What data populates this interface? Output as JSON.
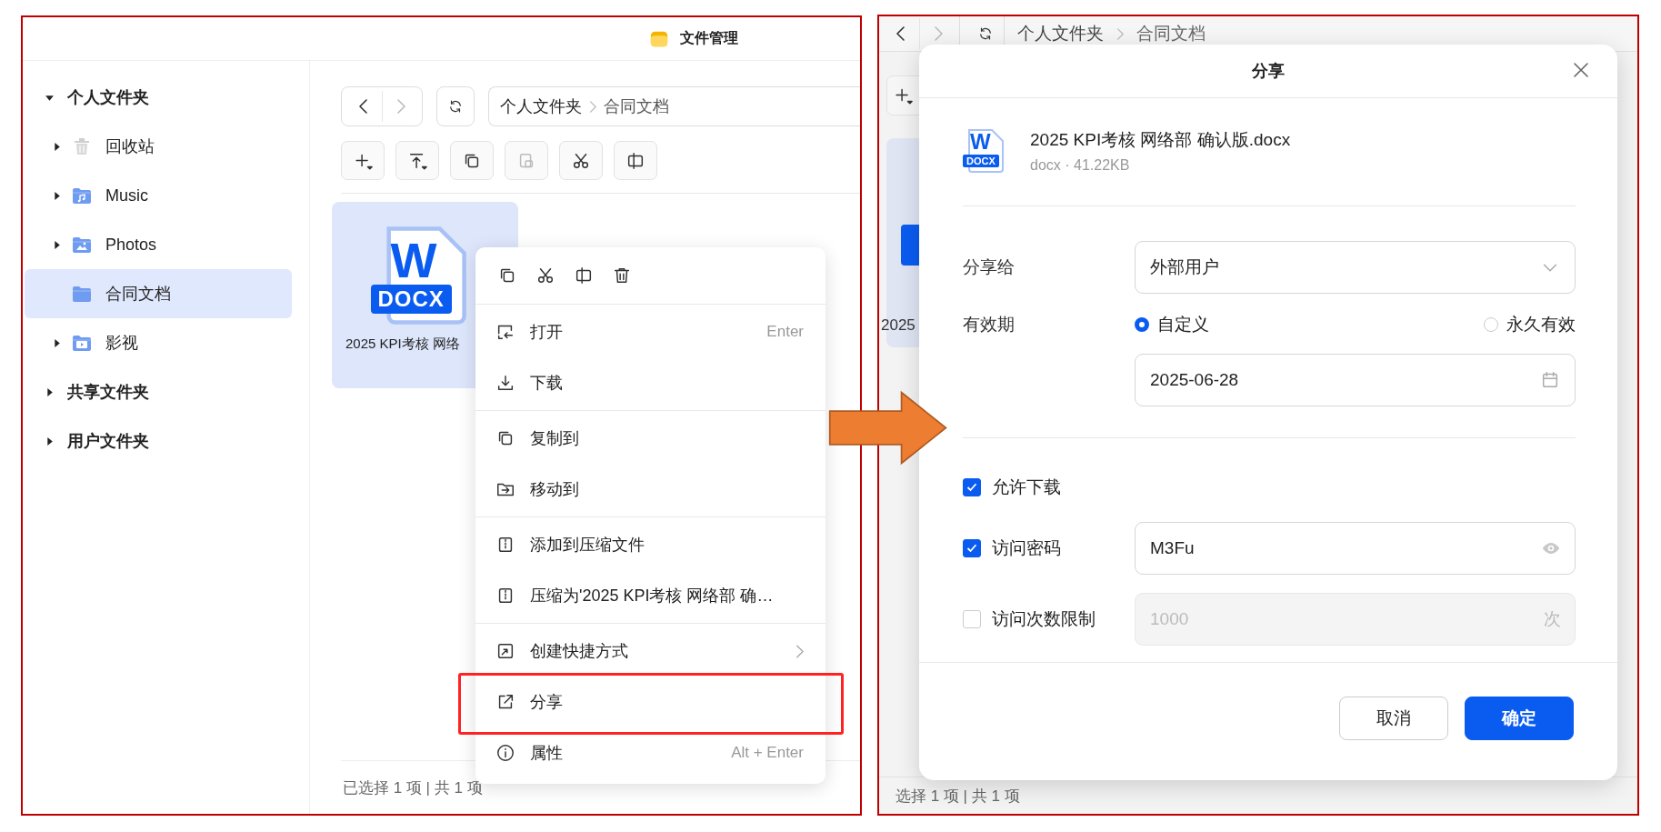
{
  "left_window": {
    "title": "文件管理",
    "sidebar": {
      "items": [
        {
          "label": "个人文件夹",
          "expanded": true,
          "selected": false,
          "children": [
            {
              "label": "回收站",
              "kind": "trash",
              "expanded": false,
              "selected": false
            },
            {
              "label": "Music",
              "kind": "music",
              "expanded": false,
              "selected": false
            },
            {
              "label": "Photos",
              "kind": "photos",
              "expanded": false,
              "selected": false
            },
            {
              "label": "合同文档",
              "kind": "folder",
              "selected": true
            },
            {
              "label": "影视",
              "kind": "video",
              "expanded": false,
              "selected": false
            }
          ]
        },
        {
          "label": "共享文件夹",
          "expanded": false,
          "selected": false
        },
        {
          "label": "用户文件夹",
          "expanded": false,
          "selected": false
        }
      ]
    },
    "nav_buttons": [
      {
        "kind": "back",
        "disabled": false
      },
      {
        "kind": "forward",
        "disabled": true
      },
      {
        "kind": "refresh",
        "disabled": false
      }
    ],
    "breadcrumb": [
      "个人文件夹",
      "合同文档"
    ],
    "toolbar": [
      {
        "kind": "new",
        "disabled": false
      },
      {
        "kind": "upload",
        "disabled": false
      },
      {
        "kind": "copy",
        "disabled": false
      },
      {
        "kind": "paste",
        "disabled": true
      },
      {
        "kind": "cut",
        "disabled": false
      },
      {
        "kind": "move",
        "disabled": false
      }
    ],
    "files": [
      {
        "name": "2025 KPI考核 网络",
        "type_letter": "W",
        "type_badge": "DOCX",
        "selected": true
      }
    ],
    "context_menu": {
      "quick_actions": [
        {
          "kind": "copy"
        },
        {
          "kind": "cut"
        },
        {
          "kind": "move"
        },
        {
          "kind": "delete"
        }
      ],
      "groups": [
        [
          {
            "label": "打开",
            "kind": "open",
            "shortcut": "Enter",
            "submenu": false,
            "highlighted": false
          },
          {
            "label": "下载",
            "kind": "download",
            "submenu": false,
            "highlighted": false
          }
        ],
        [
          {
            "label": "复制到",
            "kind": "copy",
            "submenu": false,
            "highlighted": false
          },
          {
            "label": "移动到",
            "kind": "moveto",
            "submenu": false,
            "highlighted": false
          }
        ],
        [
          {
            "label": "添加到压缩文件",
            "kind": "zip",
            "submenu": false,
            "highlighted": false
          },
          {
            "label": "压缩为'2025 KPI考核 网络部 确…",
            "kind": "zip",
            "submenu": false,
            "highlighted": false
          }
        ],
        [
          {
            "label": "创建快捷方式",
            "kind": "shortcut",
            "submenu": true,
            "highlighted": false
          },
          {
            "label": "分享",
            "kind": "share",
            "submenu": false,
            "highlighted": true
          },
          {
            "label": "属性",
            "kind": "info",
            "shortcut": "Alt + Enter",
            "submenu": false,
            "highlighted": false
          }
        ]
      ]
    },
    "status_bar": "已选择 1 项 | 共 1 项"
  },
  "right_window": {
    "background": {
      "nav_buttons": [
        {
          "kind": "back",
          "disabled": false
        },
        {
          "kind": "forward",
          "disabled": true
        },
        {
          "kind": "refresh",
          "disabled": false
        }
      ],
      "breadcrumb": [
        "个人文件夹",
        "合同文档"
      ],
      "toolbar": [
        {
          "kind": "new",
          "disabled": false
        }
      ],
      "file_name": "2025",
      "status_bar": "选择 1 项 | 共 1 项"
    },
    "dialog": {
      "title": "分享",
      "file": {
        "name": "2025 KPI考核 网络部 确认版.docx",
        "meta": "docx · 41.22KB",
        "type_letter": "W",
        "type_badge": "DOCX"
      },
      "share_to": {
        "label": "分享给",
        "value": "外部用户"
      },
      "validity": {
        "label": "有效期",
        "options": [
          {
            "label": "自定义",
            "selected": true
          },
          {
            "label": "永久有效",
            "selected": false
          }
        ],
        "date": "2025-06-28"
      },
      "options": [
        {
          "label": "允许下载",
          "checked": true
        },
        {
          "label": "访问密码",
          "checked": true,
          "field": {
            "kind": "password",
            "value": "M3Fu",
            "disabled": false
          }
        },
        {
          "label": "访问次数限制",
          "checked": false,
          "field": {
            "kind": "number",
            "placeholder": "1000",
            "suffix": "次",
            "disabled": true
          }
        }
      ],
      "buttons": [
        {
          "label": "取消",
          "kind": "secondary"
        },
        {
          "label": "确定",
          "kind": "primary"
        }
      ]
    }
  },
  "annotation_arrow": true
}
